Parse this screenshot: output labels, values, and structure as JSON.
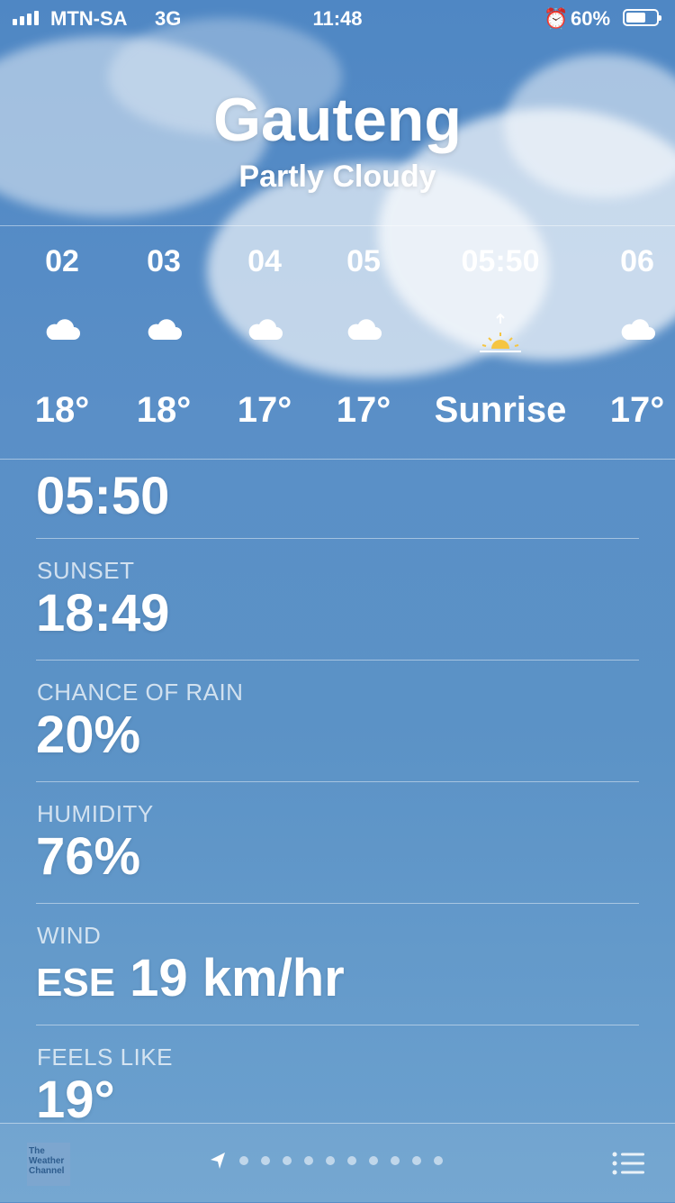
{
  "status_bar": {
    "carrier": "MTN-SA",
    "network": "3G",
    "time": "11:48",
    "battery_percent": "60%",
    "battery_level": 0.6
  },
  "location": {
    "name": "Gauteng",
    "condition": "Partly Cloudy"
  },
  "hourly": [
    {
      "time": "02",
      "icon": "cloud-icon",
      "value": "18°"
    },
    {
      "time": "03",
      "icon": "cloud-icon",
      "value": "18°"
    },
    {
      "time": "04",
      "icon": "cloud-icon",
      "value": "17°"
    },
    {
      "time": "05",
      "icon": "cloud-icon",
      "value": "17°"
    },
    {
      "time": "05:50",
      "icon": "sunrise-icon",
      "value": "Sunrise"
    },
    {
      "time": "06",
      "icon": "cloud-icon",
      "value": "17°"
    }
  ],
  "details": {
    "sunrise_value": "05:50",
    "sunset": {
      "label": "SUNSET",
      "value": "18:49"
    },
    "chance_of_rain": {
      "label": "CHANCE OF RAIN",
      "value": "20%"
    },
    "humidity": {
      "label": "HUMIDITY",
      "value": "76%"
    },
    "wind": {
      "label": "WIND",
      "direction": "ESE",
      "value": "19 km/hr"
    },
    "feels_like": {
      "label": "FEELS LIKE",
      "value": "19°"
    }
  },
  "footer": {
    "provider_logo": "The Weather Channel",
    "page_count": 11
  },
  "colors": {
    "sun": "#f5c542"
  }
}
